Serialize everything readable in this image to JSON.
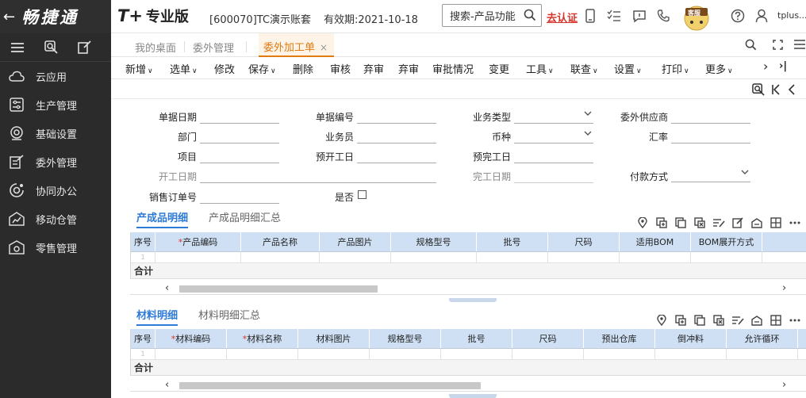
{
  "brand": {
    "back_glyph": "←",
    "name": "畅捷通"
  },
  "edition": {
    "tplus": "T+",
    "name": "专业版"
  },
  "account": "[600070]TC演示账套",
  "validity": "有效期:2021-10-18",
  "search": {
    "placeholder": "搜索-产品功能"
  },
  "verify_label": "去认证",
  "service_label": "客服",
  "user_label": "tplus...",
  "sidebar": {
    "items": [
      {
        "label": "云应用",
        "icon": "cloud-icon"
      },
      {
        "label": "生产管理",
        "icon": "production-icon"
      },
      {
        "label": "基础设置",
        "icon": "settings-icon"
      },
      {
        "label": "委外管理",
        "icon": "outsourcing-icon"
      },
      {
        "label": "协同办公",
        "icon": "collaboration-icon"
      },
      {
        "label": "移动仓管",
        "icon": "mobile-warehouse-icon"
      },
      {
        "label": "零售管理",
        "icon": "retail-icon"
      }
    ]
  },
  "tabs": {
    "desk": "我的桌面",
    "outsource": "委外管理",
    "active": "委外加工单",
    "close": "×"
  },
  "toolbar": {
    "items": [
      "新增",
      "选单",
      "修改",
      "保存",
      "删除",
      "审核",
      "弃审",
      "弃审",
      "审批情况",
      "变更",
      "工具",
      "联查",
      "设置",
      "打印",
      "更多"
    ],
    "dropdown_glyph": "∨",
    "next": "›",
    "last": "›|"
  },
  "form": {
    "doc_date": "单据日期",
    "doc_no": "单据编号",
    "biz_type": "业务类型",
    "supplier": "委外供应商",
    "dept": "部门",
    "clerk": "业务员",
    "currency": "币种",
    "rate": "汇率",
    "project": "项目",
    "plan_start": "预开工日",
    "plan_end": "预完工日",
    "start_date": "开工日期",
    "end_date": "完工日期",
    "payment": "付款方式",
    "sales_order": "销售订单号",
    "yes_no": "是否",
    "required_mark": "*"
  },
  "product_section": {
    "tab_detail": "产成品明细",
    "tab_summary": "产成品明细汇总",
    "columns": [
      "序号",
      "*产品编码",
      "*产品名称",
      "产品图片",
      "规格型号",
      "批号",
      "尺码",
      "适用BOM",
      "BOM展开方式"
    ],
    "row_no": "1",
    "total": "合计"
  },
  "material_section": {
    "tab_detail": "材料明细",
    "tab_summary": "材料明细汇总",
    "columns": [
      "序号",
      "*材料编码",
      "*材料名称",
      "材料图片",
      "规格型号",
      "批号",
      "尺码",
      "预出仓库",
      "倒冲料",
      "允许循环"
    ],
    "row_no": "1",
    "total": "合计"
  },
  "colors": {
    "accent_orange": "#e07b12",
    "accent_blue": "#2e7bd6",
    "required_red": "#d9342b",
    "sidebar_bg": "#2b2b2b",
    "grid_header": "#cfe0f5"
  }
}
